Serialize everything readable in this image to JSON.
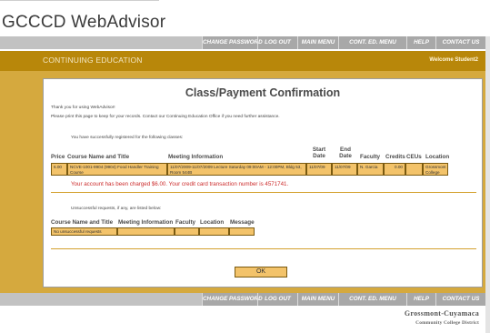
{
  "app": {
    "title": "GCCCD WebAdvisor"
  },
  "nav": {
    "items": [
      {
        "label": "Change Password"
      },
      {
        "label": "Log Out"
      },
      {
        "label": "Main Menu"
      },
      {
        "label": "Cont. Ed. Menu"
      },
      {
        "label": "Help"
      },
      {
        "label": "Contact Us"
      }
    ]
  },
  "section": {
    "title": "Continuing Education",
    "welcome": "Welcome Student2"
  },
  "page": {
    "title": "Class/Payment Confirmation",
    "thanks": "Thank you for using WebAdvisor!",
    "print_note": "Please print this page to keep for your records. Contact our Continuing Education Office if you need further assistance.",
    "registered_intro": "You have successfully registered for the following classes:",
    "charge_message": "Your account has been charged $6.00.  Your credit card transaction number is 4571741.",
    "unsuccessful_intro": "Unsuccessful requests, if any, are listed below:",
    "ok_label": "OK"
  },
  "registered_table": {
    "headers": {
      "price": "Price",
      "course": "Course Name and Title",
      "meeting": "Meeting Information",
      "start": "Start Date",
      "end": "End Date",
      "faculty": "Faculty",
      "credits": "Credits",
      "ceus": "CEUs",
      "location": "Location"
    },
    "rows": [
      {
        "price": "6.00",
        "course": "NCVE-1001-9904 (9904) Food Handler Training Course",
        "meeting": "11/07/2009-11/07/2009 Lecture Saturday 09:00AM - 12:00PM, Bldg 53, Room 544B",
        "start": "11/07/09",
        "end": "11/07/09",
        "faculty": "N. Garcia",
        "credits": "0.00",
        "ceus": "",
        "location": "Grossmont College"
      }
    ]
  },
  "unsuccessful_table": {
    "headers": {
      "course": "Course Name and Title",
      "meeting": "Meeting Information",
      "faculty": "Faculty",
      "location": "Location",
      "message": "Message"
    },
    "rows": [
      {
        "course": "No unsuccessful requests",
        "meeting": "",
        "faculty": "",
        "location": "",
        "message": ""
      }
    ]
  },
  "footer": {
    "logo_line1": "Grossmont-Cuyamaca",
    "logo_line2": "Community College District"
  }
}
